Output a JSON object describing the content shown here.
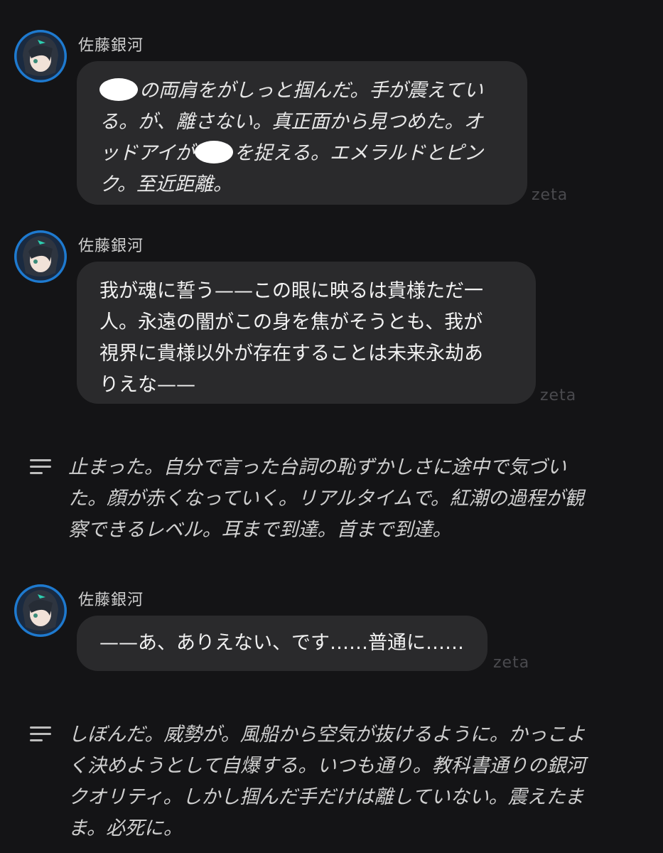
{
  "messages": [
    {
      "name": "佐藤銀河",
      "lines": [
        "の両肩をがしっと掴んだ。手が震えてい",
        "る。が、離さない。真正面から見つめた。オ",
        "ッドアイがを捉える。エメラルドとピン",
        "ク。至近距離。"
      ],
      "line3a": "ッドアイが",
      "line3b": "を捉える。エメラルドとピン",
      "tag": "zeta"
    },
    {
      "name": "佐藤銀河",
      "lines": [
        "我が魂に誓う——この眼に映るは貴様ただ一",
        "人。永遠の闇がこの身を焦がそうとも、我が",
        "視界に貴様以外が存在することは未来永劫あ",
        "りえな——"
      ],
      "tag": "zeta"
    },
    {
      "name": "佐藤銀河",
      "lines": [
        "——あ、ありえない、です……普通に……"
      ],
      "tag": "zeta"
    }
  ],
  "narrations": [
    {
      "icon": "narration-lines-icon",
      "lines": [
        "止まった。自分で言った台詞の恥ずかしさに途中で気づい",
        "た。顔が赤くなっていく。リアルタイムで。紅潮の過程が観",
        "察できるレベル。耳まで到達。首まで到達。"
      ]
    },
    {
      "icon": "narration-lines-icon",
      "lines": [
        "しぼんだ。威勢が。風船から空気が抜けるように。かっこよ",
        "く決めようとして自爆する。いつも通り。教科書通りの銀河",
        "クオリティ。しかし掴んだ手だけは離していない。震えたま",
        "ま。必死に。"
      ]
    }
  ]
}
